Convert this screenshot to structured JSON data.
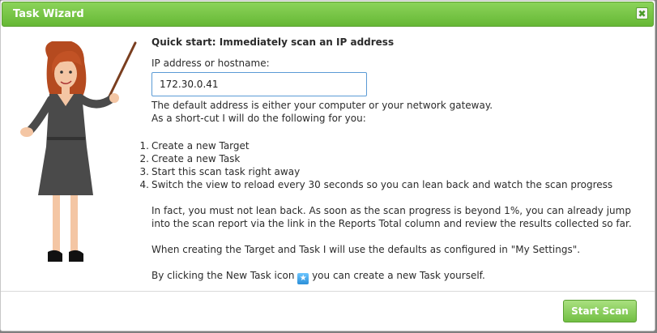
{
  "dialog": {
    "title": "Task Wizard",
    "close_icon": "close-icon",
    "close_glyph": "✖"
  },
  "content": {
    "heading": "Quick start: Immediately scan an IP address",
    "ip_label": "IP address or hostname:",
    "ip_value": "172.30.0.41",
    "default_note_1": "The default address is either your computer or your network gateway.",
    "default_note_2": "As a short-cut I will do the following for you:",
    "steps": [
      {
        "num": "1.",
        "text": "Create a new Target"
      },
      {
        "num": "2.",
        "text": "Create a new Task"
      },
      {
        "num": "3.",
        "text": "Start this scan task right away"
      },
      {
        "num": "4.",
        "text": "Switch the view to reload every 30 seconds so you can lean back and watch the scan progress"
      }
    ],
    "para_lean": "In fact, you must not lean back. As soon as the scan progress is beyond 1%, you can already jump into the scan report via the link in the Reports Total column and review the results collected so far.",
    "para_defaults": "When creating the Target and Task I will use the defaults as configured in \"My Settings\".",
    "para_newtask_before": "By clicking the New Task icon",
    "para_newtask_after": "you can create a new Task yourself.",
    "new_task_icon": "star-icon"
  },
  "footer": {
    "start_label": "Start Scan"
  },
  "colors": {
    "title_green": "#66b835",
    "accent_blue": "#5b9bd5"
  }
}
